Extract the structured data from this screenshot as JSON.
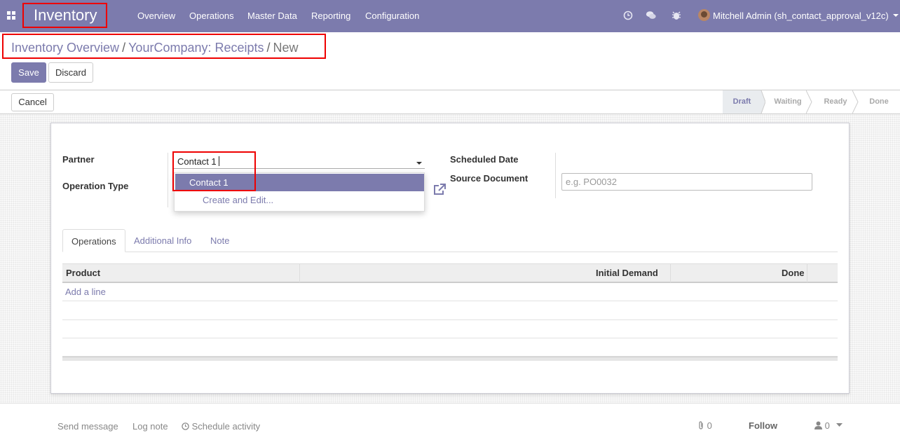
{
  "navbar": {
    "app_title": "Inventory",
    "menu": [
      "Overview",
      "Operations",
      "Master Data",
      "Reporting",
      "Configuration"
    ],
    "user_label": "Mitchell Admin (sh_contact_approval_v12c)",
    "bg_color": "#7c7bad"
  },
  "breadcrumb": {
    "items": [
      "Inventory Overview",
      "YourCompany: Receipts"
    ],
    "current": "New"
  },
  "buttons": {
    "save": "Save",
    "discard": "Discard",
    "cancel": "Cancel"
  },
  "stages": [
    "Draft",
    "Waiting",
    "Ready",
    "Done"
  ],
  "stage_active": "Draft",
  "form": {
    "partner_label": "Partner",
    "partner_value": "Contact 1",
    "operation_type_label": "Operation Type",
    "scheduled_date_label": "Scheduled Date",
    "source_document_label": "Source Document",
    "source_document_placeholder": "e.g. PO0032"
  },
  "dropdown": {
    "option": "Contact 1",
    "create_edit": "Create and Edit..."
  },
  "tabs": [
    "Operations",
    "Additional Info",
    "Note"
  ],
  "table": {
    "columns": [
      "Product",
      "Initial Demand",
      "Done"
    ],
    "add_line": "Add a line"
  },
  "chatter": {
    "send_message": "Send message",
    "log_note": "Log note",
    "schedule_activity": "Schedule activity",
    "attachments": "0",
    "follow": "Follow",
    "followers": "0"
  }
}
